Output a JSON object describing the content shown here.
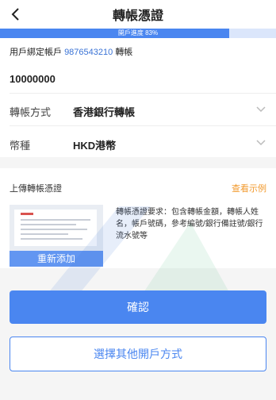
{
  "header": {
    "title": "轉帳憑證",
    "back_icon": "chevron-left-icon"
  },
  "progress": {
    "text": "開戶進度 83%",
    "percent": 83
  },
  "bound_account": {
    "label": "用戶綁定帳戶",
    "number": "9876543210",
    "suffix": "轉帳"
  },
  "amount": "10000000",
  "transfer_method": {
    "label": "轉帳方式",
    "value": "香港銀行轉帳"
  },
  "currency": {
    "label": "幣種",
    "value": "HKD港幣"
  },
  "upload": {
    "title": "上傳轉帳憑證",
    "example_link": "查看示例",
    "reupload_label": "重新添加",
    "description": "轉帳憑證要求：包含轉帳金額，轉帳人姓名，帳戶號碼，參考編號/銀行備註號/銀行流水號等"
  },
  "buttons": {
    "confirm": "確認",
    "other_method": "選擇其他開戶方式"
  },
  "colors": {
    "accent": "#4a86f0",
    "link": "#3a73d6",
    "example": "#f29a2e"
  }
}
